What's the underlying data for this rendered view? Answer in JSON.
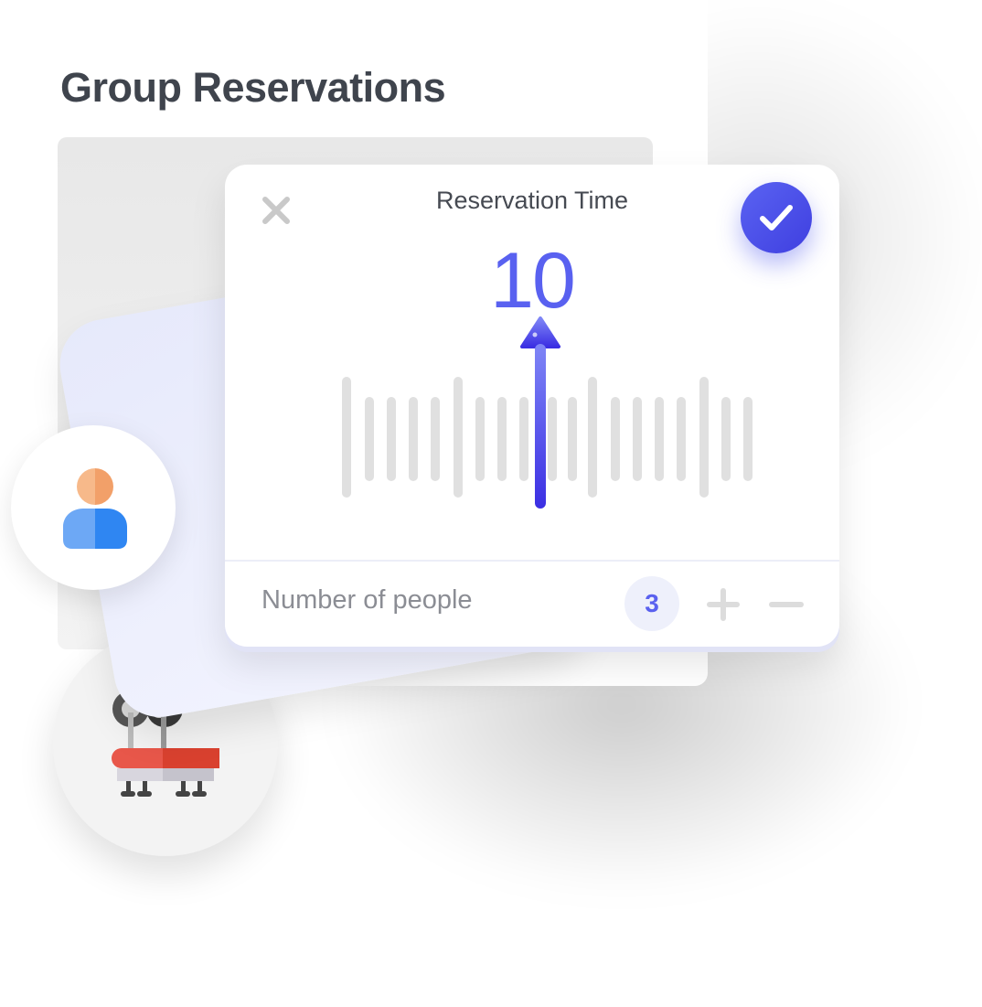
{
  "page": {
    "title": "Group Reservations"
  },
  "modal": {
    "title": "Reservation Time",
    "time_value": "10",
    "people_label": "Number of people",
    "people_count": "3"
  },
  "icons": {
    "close": "close-icon",
    "confirm": "check-icon",
    "plus": "plus-icon",
    "minus": "minus-icon",
    "avatar": "user-avatar-icon",
    "table": "dining-table-icon",
    "pointer": "arrow-up-icon"
  },
  "colors": {
    "accent": "#5961F0",
    "title_text": "#3F444D",
    "muted_text": "#8B8D94",
    "tick": "#E0E0E0"
  }
}
